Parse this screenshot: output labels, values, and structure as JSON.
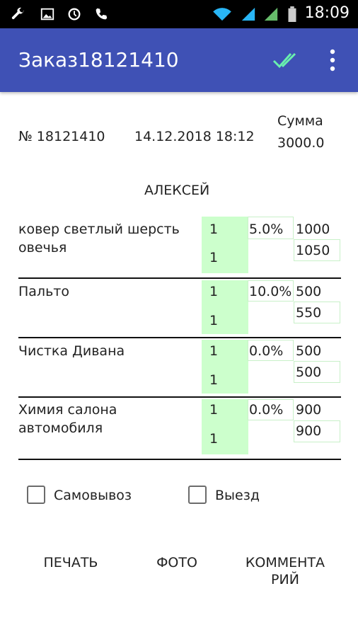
{
  "status_bar": {
    "time": "18:09",
    "icons": [
      "wrench-icon",
      "image-icon",
      "sync-icon",
      "phone-icon",
      "wifi-icon",
      "signal-icon",
      "signal-icon",
      "battery-icon"
    ]
  },
  "app_bar": {
    "title": "Заказ18121410",
    "actions": [
      "done-all-icon",
      "more-vert-icon"
    ]
  },
  "order": {
    "number": "№ 18121410",
    "datetime": "14.12.2018 18:12",
    "sum_label": "Сумма",
    "sum_value": "3000.0",
    "customer": "АЛЕКСЕЙ"
  },
  "items": [
    {
      "name_line1": "ковер светлый шерсть",
      "name_line2": "овечья",
      "qty1": "1",
      "qty2": "1",
      "discount": "5.0%",
      "price": "1000",
      "total": "1050"
    },
    {
      "name_line1": "Пальто",
      "name_line2": "",
      "qty1": "1",
      "qty2": "1",
      "discount": "10.0%",
      "price": "500",
      "total": "550"
    },
    {
      "name_line1": "Чистка Дивана",
      "name_line2": "",
      "qty1": "1",
      "qty2": "1",
      "discount": "0.0%",
      "price": "500",
      "total": "500"
    },
    {
      "name_line1": "Химия салона",
      "name_line2": "автомобиля",
      "qty1": "1",
      "qty2": "1",
      "discount": "0.0%",
      "price": "900",
      "total": "900"
    }
  ],
  "options": {
    "pickup_label": "Самовывоз",
    "pickup_checked": false,
    "visit_label": "Выезд",
    "visit_checked": false
  },
  "actions": {
    "print": "ПЕЧАТЬ",
    "photo": "ФОТО",
    "comment_line1": "КОММЕНТА",
    "comment_line2": "РИЙ"
  },
  "colors": {
    "app_bar": "#3f51b5",
    "accent_check": "#69f0ae",
    "qty_highlight": "#ccffcc"
  }
}
